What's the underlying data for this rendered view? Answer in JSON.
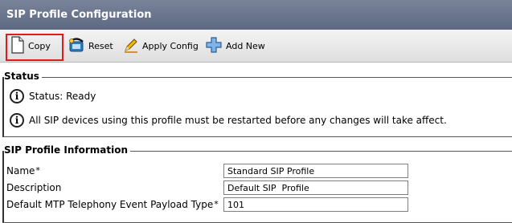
{
  "page": {
    "title": "SIP Profile Configuration"
  },
  "toolbar": {
    "copy_label": "Copy",
    "reset_label": "Reset",
    "apply_config_label": "Apply Config",
    "add_new_label": "Add New"
  },
  "status": {
    "legend": "Status",
    "ready_text": "Status: Ready",
    "notice_text": "All SIP devices using this profile must be restarted before any changes will take affect."
  },
  "sip_info": {
    "legend": "SIP Profile Information",
    "fields": [
      {
        "label": "Name",
        "required": "*",
        "value": "Standard SIP Profile"
      },
      {
        "label": "Description",
        "required": "",
        "value": "Default SIP  Profile"
      },
      {
        "label": "Default MTP Telephony Event Payload Type",
        "required": "*",
        "value": "101"
      }
    ]
  },
  "icons": {
    "copy": "copy-document-icon",
    "reset": "reset-phone-icon",
    "apply_config": "pencil-icon",
    "add_new": "plus-icon",
    "info": "info-icon"
  },
  "colors": {
    "title_bar": "#6b7590",
    "highlight": "#e01b1b"
  }
}
